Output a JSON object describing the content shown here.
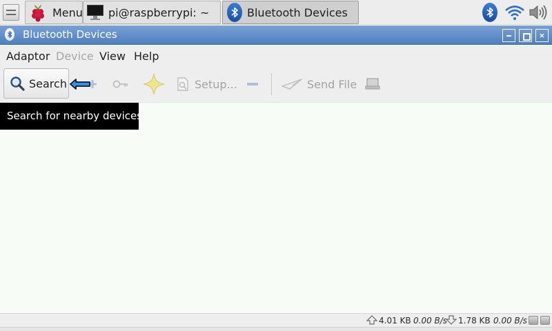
{
  "taskbar": {
    "menu_label": "Menu",
    "terminal_label": "pi@raspberrypi: ~",
    "bluetooth_task_label": "Bluetooth Devices",
    "icons": {
      "file_manager": "file-manager-icon",
      "menu": "raspberry-pi-icon",
      "terminal": "terminal-icon",
      "bluetooth_task": "bluetooth-icon",
      "tray": [
        "bluetooth-icon",
        "wifi-icon",
        "volume-icon"
      ]
    }
  },
  "window": {
    "title": "Bluetooth Devices",
    "controls": [
      "minimize",
      "maximize",
      "close"
    ]
  },
  "menubar": {
    "items": [
      {
        "label": "Adaptor",
        "enabled": true
      },
      {
        "label": "Device",
        "enabled": false
      },
      {
        "label": "View",
        "enabled": true
      },
      {
        "label": "Help",
        "enabled": true
      }
    ]
  },
  "toolbar": {
    "search_label": "Search",
    "setup_label": "Setup...",
    "send_file_label": "Send File",
    "icons": [
      "search-icon",
      "add-icon",
      "key-icon",
      "trust-star-icon",
      "setup-icon",
      "remove-icon",
      "send-file-icon",
      "browse-icon"
    ]
  },
  "tooltip": {
    "text": "Search for nearby devices"
  },
  "statusbar": {
    "upload": "4.01 KB",
    "upload_rate": "0.00 B/s",
    "download": "1.78 KB",
    "download_rate": "0.00 B/s"
  },
  "colors": {
    "titlebar": "#6a92cc",
    "content_bg": "#f7fcf7",
    "tooltip_bg": "#000000",
    "bluetooth_blue": "#2a63b8"
  }
}
